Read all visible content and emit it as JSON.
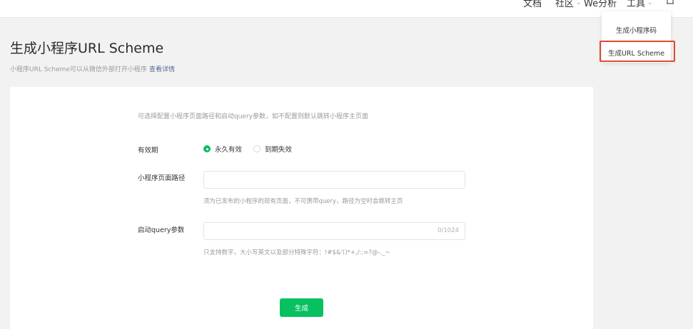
{
  "nav": {
    "docs": "文档",
    "community": "社区",
    "we_analysis": "We分析",
    "tools": "工具"
  },
  "dropdown": {
    "items": [
      "生成小程序码",
      "生成URL Scheme"
    ],
    "selected_index": 1
  },
  "page": {
    "title": "生成小程序URL Scheme",
    "description": "小程序URL Scheme可以从微信外部打开小程序",
    "details_link": "查看详情"
  },
  "form": {
    "hint": "可选择配置小程序页面路径和启动query参数，如不配置则默认跳转小程序主页面",
    "validity": {
      "label": "有效期",
      "options": [
        "永久有效",
        "到期失效"
      ],
      "selected_index": 0
    },
    "path": {
      "label": "小程序页面路径",
      "value": "",
      "tip": "须为已发布的小程序的现有页面，不可携带query，路径为空时会跳转主页"
    },
    "query": {
      "label": "启动query参数",
      "value": "",
      "counter": "0/1024",
      "tip": "只支持数字，大小写英文以及部分特殊字符：!#$&'()*+,/:;=?@-._~"
    },
    "submit_label": "生成"
  },
  "colors": {
    "accent": "#07c160",
    "link": "#576b95",
    "highlight_border": "#e0492f"
  }
}
